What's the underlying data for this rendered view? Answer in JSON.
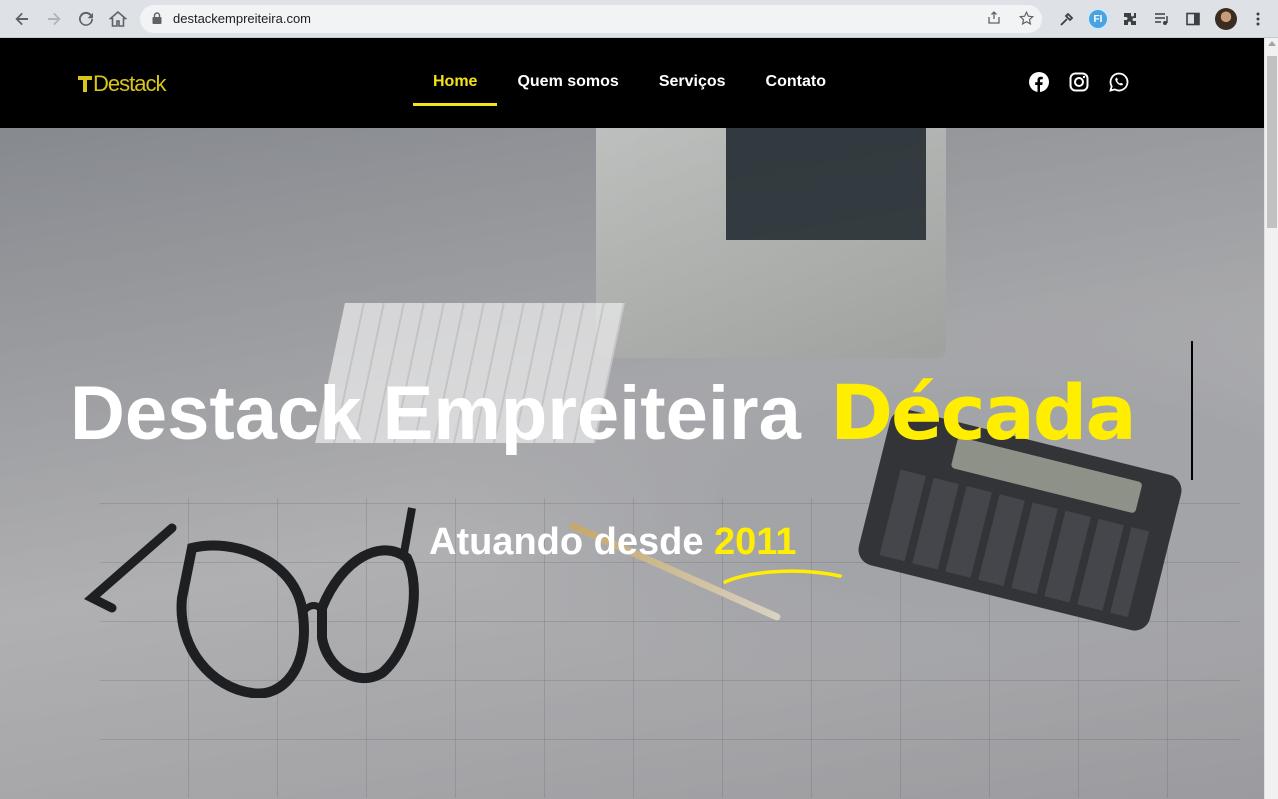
{
  "browser": {
    "url": "destackempreiteira.com"
  },
  "site": {
    "logo": "Destack",
    "nav": [
      {
        "label": "Home",
        "active": true
      },
      {
        "label": "Quem somos",
        "active": false
      },
      {
        "label": "Serviços",
        "active": false
      },
      {
        "label": "Contato",
        "active": false
      }
    ],
    "social_icons": [
      "facebook-icon",
      "instagram-icon",
      "whatsapp-icon"
    ]
  },
  "hero": {
    "title": "Destack Empreiteira",
    "title_highlight": "Década",
    "subtitle": "Atuando desde",
    "subtitle_highlight": "2011"
  },
  "colors": {
    "accent": "#ffee00",
    "nav_active": "#f5e21b",
    "logo": "#d9c41a",
    "header_bg": "#000000"
  }
}
